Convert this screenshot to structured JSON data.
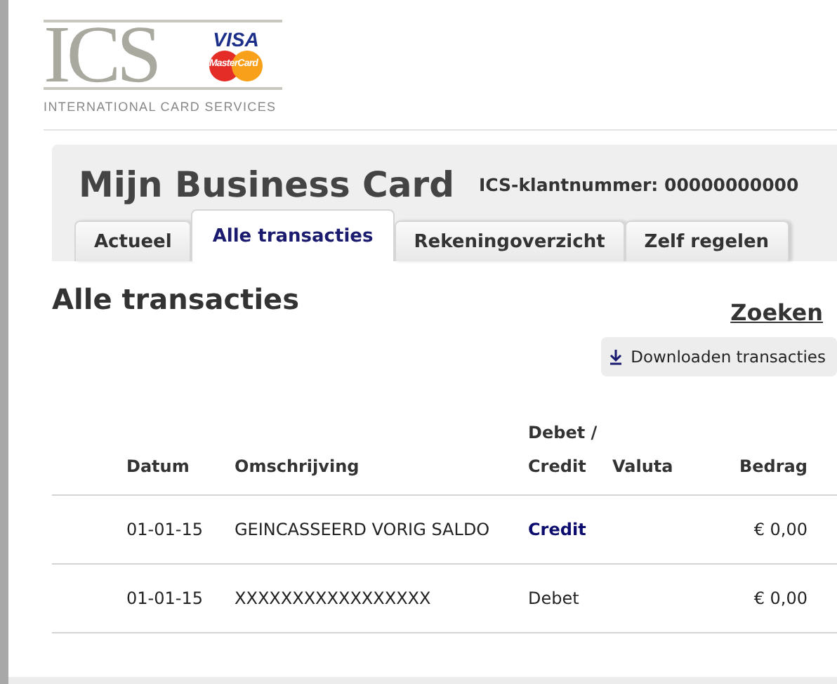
{
  "logo": {
    "wordmark": "ICS",
    "visa": "VISA",
    "mastercard": "MasterCard",
    "tagline": "INTERNATIONAL CARD SERVICES"
  },
  "header": {
    "title": "Mijn Business Card",
    "customer_number": "ICS-klantnummer: 00000000000"
  },
  "tabs": [
    {
      "label": "Actueel",
      "selected": false
    },
    {
      "label": "Alle transacties",
      "selected": true
    },
    {
      "label": "Rekeningoverzicht",
      "selected": false
    },
    {
      "label": "Zelf regelen",
      "selected": false
    }
  ],
  "page_title": "Alle transacties",
  "search_link": "Zoeken",
  "download_button": "Downloaden transacties",
  "table": {
    "columns": [
      "Datum",
      "Omschrijving",
      "Debet / Credit",
      "Valuta",
      "Bedrag"
    ],
    "rows": [
      {
        "date": "01-01-15",
        "description": "GEINCASSEERD VORIG SALDO",
        "type": "Credit",
        "kind": "credit",
        "amount": "€ 0,00"
      },
      {
        "date": "01-01-15",
        "description": "XXXXXXXXXXXXXXXXX",
        "type": "Debet",
        "kind": "debet",
        "amount": "€ 0,00"
      }
    ]
  }
}
